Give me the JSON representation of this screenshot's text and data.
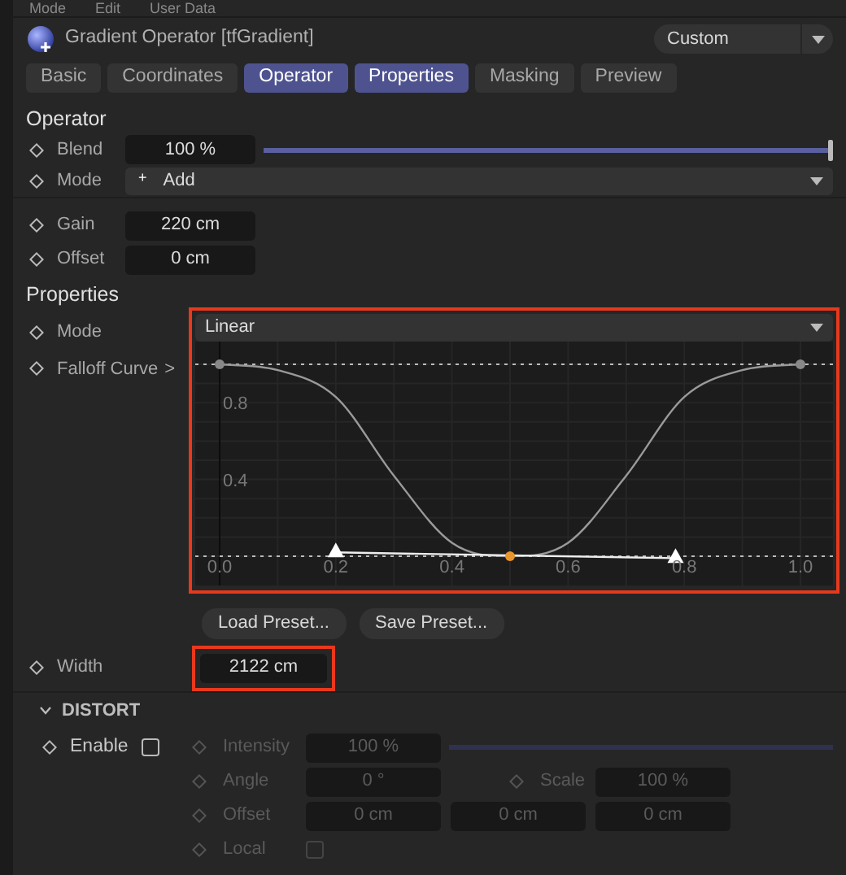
{
  "menu": [
    "Mode",
    "Edit",
    "User Data"
  ],
  "header": {
    "title": "Gradient Operator [tfGradient]",
    "preset": "Custom"
  },
  "tabs": [
    {
      "label": "Basic",
      "selected": false
    },
    {
      "label": "Coordinates",
      "selected": false
    },
    {
      "label": "Operator",
      "selected": true
    },
    {
      "label": "Properties",
      "selected": true
    },
    {
      "label": "Masking",
      "selected": false
    },
    {
      "label": "Preview",
      "selected": false
    }
  ],
  "operator": {
    "title": "Operator",
    "blend": {
      "label": "Blend",
      "value": "100 %",
      "level": 1
    },
    "mode": {
      "label": "Mode",
      "icon": "+",
      "value": "Add"
    },
    "gain": {
      "label": "Gain",
      "value": "220 cm"
    },
    "offset": {
      "label": "Offset",
      "value": "0 cm"
    }
  },
  "properties": {
    "title": "Properties",
    "highlighted": true,
    "mode": {
      "label": "Mode",
      "value": "Linear"
    },
    "falloff": {
      "label": "Falloff Curve",
      "chevron": ">",
      "chart_data": {
        "type": "line",
        "grid": true,
        "x": [
          0,
          0.1,
          0.2,
          0.3,
          0.4,
          0.5,
          0.6,
          0.7,
          0.8,
          0.9,
          1
        ],
        "xlim": [
          0,
          1
        ],
        "ylim": [
          0,
          1
        ],
        "xticks": [
          {
            "value": 0,
            "label": "0.0"
          },
          {
            "value": 0.2,
            "label": "0.2"
          },
          {
            "value": 0.4,
            "label": "0.4"
          },
          {
            "value": 0.6,
            "label": "0.6"
          },
          {
            "value": 0.8,
            "label": "0.8"
          },
          {
            "value": 1,
            "label": "1.0"
          }
        ],
        "yticks": [
          {
            "value": 0.4,
            "label": "0.4"
          },
          {
            "value": 0.8,
            "label": "0.8"
          }
        ],
        "series": [
          {
            "color": "#9a9a9a",
            "values": [
              1,
              0.97,
              0.83,
              0.42,
              0.07,
              0,
              0.07,
              0.42,
              0.83,
              0.97,
              1
            ]
          }
        ]
      }
    },
    "buttons": [
      "Load Preset...",
      "Save Preset..."
    ],
    "width": {
      "label": "Width",
      "value": "2122 cm",
      "highlighted": true
    }
  },
  "distort": {
    "title": "DISTORT",
    "expanded": true,
    "enable": {
      "label": "Enable",
      "checked": false
    },
    "params": [
      {
        "kind": "slider",
        "label": "Intensity",
        "value": "100 %",
        "level": 1,
        "disabled": true
      },
      {
        "kind": "pair",
        "label": "Angle",
        "value": "0 °",
        "label_2": "Scale",
        "value_2": "100 %",
        "disabled": true
      },
      {
        "kind": "vector",
        "label": "Offset",
        "values": [
          "0 cm",
          "0 cm",
          "0 cm"
        ],
        "disabled": true
      },
      {
        "kind": "checkbox",
        "label": "Local",
        "checked": false,
        "disabled": true
      }
    ]
  }
}
